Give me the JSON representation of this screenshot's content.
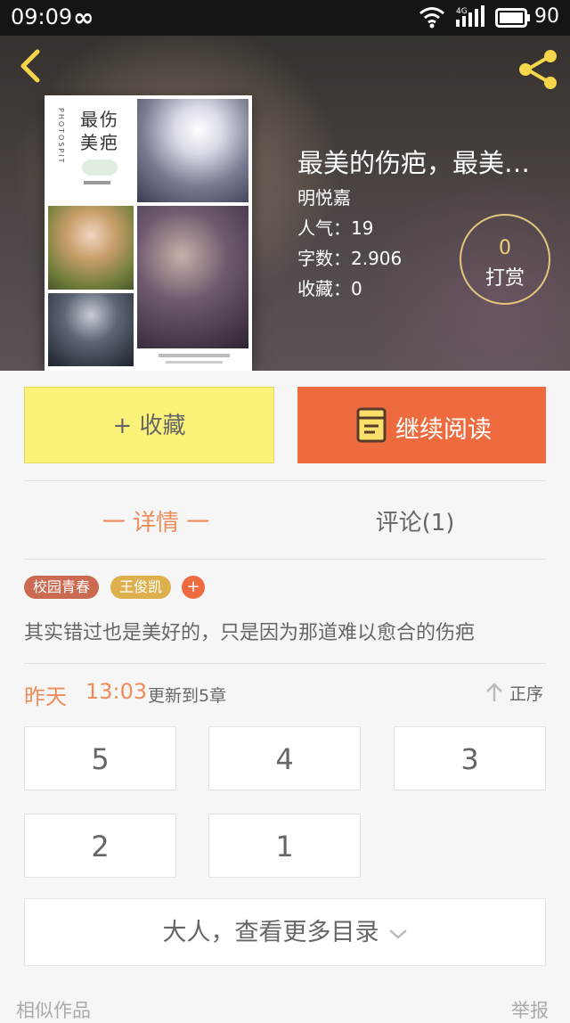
{
  "status_bar": {
    "time": "09:09",
    "loop_glyph": "∞",
    "battery": "90",
    "network": "4G"
  },
  "book": {
    "title": "最美的伤疤，最美…",
    "author": "明悦嘉",
    "popularity": "人气：19",
    "word_count": "字数：2.906",
    "favorites": "收藏：0",
    "tip_count": "0",
    "tip_label": "打赏",
    "cover_title": "最伤美疤",
    "cover_vertical": "PHOTOSPIT"
  },
  "actions": {
    "favorite": "+ 收藏",
    "continue_reading": "继续阅读"
  },
  "tabs": {
    "detail": "一 详情 一",
    "comments": "评论(1)"
  },
  "tags": [
    "校园青春",
    "王俊凯",
    "+"
  ],
  "summary": "其实错过也是美好的，只是因为那道难以愈合的伤疤",
  "update": {
    "day": "昨天",
    "time": "13:03",
    "text": "更新到5章",
    "order": "正序"
  },
  "chapters": [
    "5",
    "4",
    "3",
    "2",
    "1"
  ],
  "more_catalog": "大人，查看更多目录",
  "footer": {
    "similar": "相似作品",
    "report": "举报"
  },
  "colors": {
    "accent": "#ed6b3e",
    "favorite_bg": "#fbf27a",
    "tab_active": "#ee8c5b",
    "tip_ring": "#e3c77c"
  }
}
